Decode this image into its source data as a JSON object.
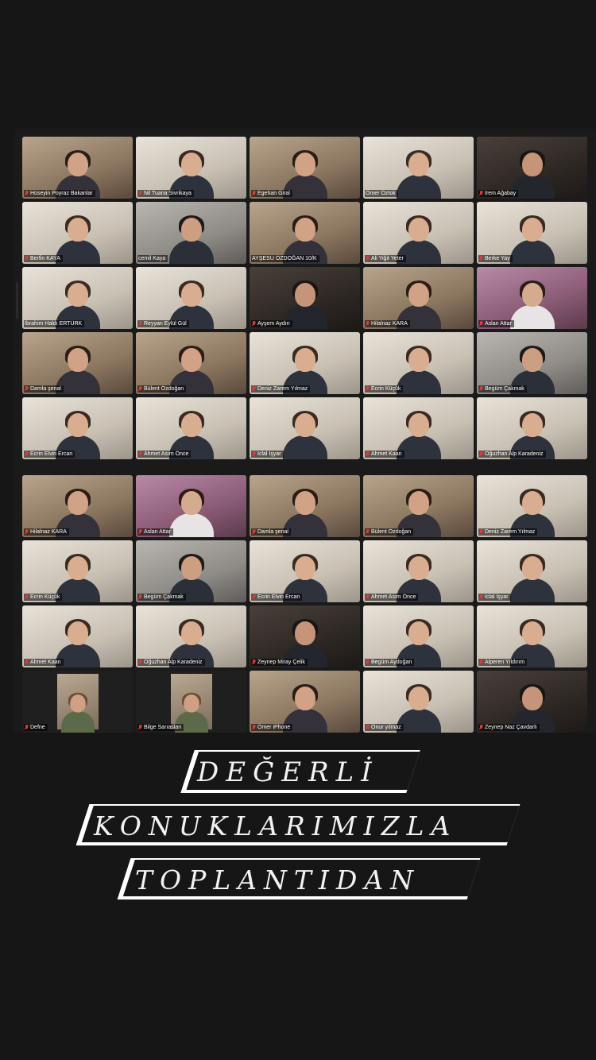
{
  "meeting": {
    "top_grid": [
      {
        "name": "Hüseyin Poyraz Bakanlar",
        "muted": true,
        "tone": "warm"
      },
      {
        "name": "Nil Tuana Sivrikaya",
        "muted": true,
        "tone": "light"
      },
      {
        "name": "Egehan Giral",
        "muted": true,
        "tone": "warm"
      },
      {
        "name": "Ömer Öztok",
        "muted": false,
        "tone": "light",
        "active": true
      },
      {
        "name": "İrem Ağabay",
        "muted": true,
        "tone": "dark"
      },
      {
        "name": "Berfin KAYA",
        "muted": true,
        "tone": "light"
      },
      {
        "name": "cemil Kaya",
        "muted": false,
        "tone": "grey"
      },
      {
        "name": "AYŞESU ÖZDOĞAN 10/K",
        "muted": false,
        "tone": "warm"
      },
      {
        "name": "Ali Yiğit Yeter",
        "muted": true,
        "tone": "light"
      },
      {
        "name": "Berke Yay",
        "muted": true,
        "tone": "light"
      },
      {
        "name": "İbrahim Haldı ERTÜRK",
        "muted": false,
        "tone": "light"
      },
      {
        "name": "Reyyan Eylül Gül",
        "muted": true,
        "tone": "light"
      },
      {
        "name": "Ayşem Aydın",
        "muted": true,
        "tone": "dark"
      },
      {
        "name": "Hilalnaz KARA",
        "muted": true,
        "tone": "warm"
      },
      {
        "name": "Aslan Attar",
        "muted": true,
        "tone": "pink"
      },
      {
        "name": "Damla şenal",
        "muted": true,
        "tone": "warm"
      },
      {
        "name": "Bülent Özdoğan",
        "muted": true,
        "tone": "warm"
      },
      {
        "name": "Deniz Zarem Yılmaz",
        "muted": true,
        "tone": "light"
      },
      {
        "name": "Ecrin Küçük",
        "muted": true,
        "tone": "light"
      },
      {
        "name": "Begüm Çakmak",
        "muted": true,
        "tone": "grey"
      },
      {
        "name": "Ecrin Elvin Ercan",
        "muted": true,
        "tone": "light"
      },
      {
        "name": "Ahmet Asım Önce",
        "muted": true,
        "tone": "light"
      },
      {
        "name": "İclal İşyar",
        "muted": true,
        "tone": "light"
      },
      {
        "name": "Ahmet Kaan",
        "muted": true,
        "tone": "light"
      },
      {
        "name": "Oğuzhan Alp Karadeniz",
        "muted": true,
        "tone": "light"
      }
    ],
    "bottom_grid": [
      {
        "name": "Hilalnaz KARA",
        "muted": true,
        "tone": "warm"
      },
      {
        "name": "Aslan Attar",
        "muted": true,
        "tone": "pink"
      },
      {
        "name": "Damla şenal",
        "muted": true,
        "tone": "warm"
      },
      {
        "name": "Bülent Özdoğan",
        "muted": true,
        "tone": "warm"
      },
      {
        "name": "Deniz Zarem Yılmaz",
        "muted": true,
        "tone": "light"
      },
      {
        "name": "Ecrin Küçük",
        "muted": true,
        "tone": "light"
      },
      {
        "name": "Begüm Çakmak",
        "muted": true,
        "tone": "grey"
      },
      {
        "name": "Ecrin Elvin Ercan",
        "muted": true,
        "tone": "light"
      },
      {
        "name": "Ahmet Asım Önce",
        "muted": true,
        "tone": "light"
      },
      {
        "name": "İclal İşyar",
        "muted": true,
        "tone": "light"
      },
      {
        "name": "Ahmet Kaan",
        "muted": true,
        "tone": "light"
      },
      {
        "name": "Oğuzhan Alp Karadeniz",
        "muted": true,
        "tone": "light"
      },
      {
        "name": "Zeynep Miray Çelik",
        "muted": true,
        "tone": "dark"
      },
      {
        "name": "Begüm Aydoğan",
        "muted": true,
        "tone": "light"
      },
      {
        "name": "Alperen Yıldırım",
        "muted": true,
        "tone": "light"
      },
      {
        "name": "Defne",
        "muted": true,
        "tone": "empty"
      },
      {
        "name": "Bilge Sarıaslan",
        "muted": true,
        "tone": "empty"
      },
      {
        "name": "Ömer iPhone",
        "muted": true,
        "tone": "warm"
      },
      {
        "name": "Onur yılmaz",
        "muted": true,
        "tone": "light"
      },
      {
        "name": "Zeynep Naz Çavdarlı",
        "muted": true,
        "tone": "dark"
      }
    ]
  },
  "caption": {
    "line1": "DEĞERLİ",
    "line2": "KONUKLARIMIZLA",
    "line3": "TOPLANTIDAN"
  },
  "colors": {
    "background": "#161616",
    "active_speaker": "#3ec43e",
    "muted_icon": "#e03a3a",
    "banner": "#ffffff"
  }
}
